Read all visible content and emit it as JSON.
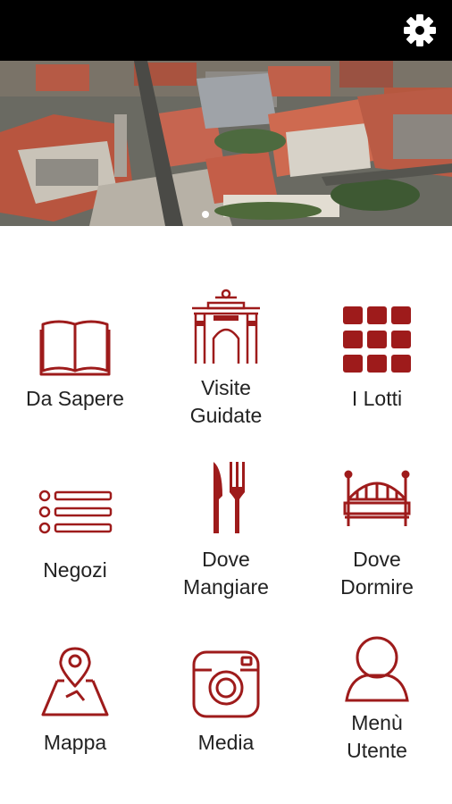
{
  "topbar": {
    "settings_icon": "gear-icon"
  },
  "hero": {
    "pager_dots": 1,
    "active_dot": 0
  },
  "accent_color": "#9e1b1b",
  "menu": [
    {
      "label": "Da Sapere",
      "icon": "open-book-icon"
    },
    {
      "label": "Visite\nGuidate",
      "icon": "arch-gate-icon"
    },
    {
      "label": "I Lotti",
      "icon": "grid-squares-icon"
    },
    {
      "label": "Negozi",
      "icon": "list-icon"
    },
    {
      "label": "Dove\nMangiare",
      "icon": "knife-fork-icon"
    },
    {
      "label": "Dove\nDormire",
      "icon": "bed-icon"
    },
    {
      "label": "Mappa",
      "icon": "map-pin-icon"
    },
    {
      "label": "Media",
      "icon": "camera-icon"
    },
    {
      "label": "Menù\nUtente",
      "icon": "user-icon"
    }
  ]
}
